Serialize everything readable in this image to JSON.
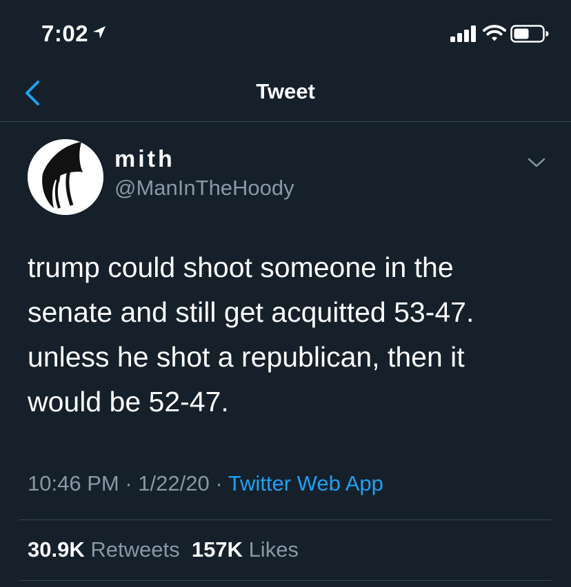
{
  "status_bar": {
    "time": "7:02"
  },
  "nav": {
    "title": "Tweet"
  },
  "tweet": {
    "display_name": "mith",
    "handle": "@ManInTheHoody",
    "text_lines": [
      "trump could shoot someone in the",
      "senate and still get acquitted 53-47.",
      "unless he shot a republican, then it",
      "would be 52-47."
    ],
    "time": "10:46 PM",
    "date": "1/22/20",
    "separator": "·",
    "source": "Twitter Web App",
    "retweets_count": "30.9K",
    "retweets_label": "Retweets",
    "likes_count": "157K",
    "likes_label": "Likes"
  },
  "colors": {
    "background": "#15202b",
    "accent": "#1da1f2",
    "secondary_text": "#8899a6",
    "divider": "#38444d"
  },
  "icons": [
    "location-arrow-icon",
    "signal-icon",
    "wifi-icon",
    "battery-icon",
    "back-chevron-icon",
    "chevron-down-icon"
  ]
}
